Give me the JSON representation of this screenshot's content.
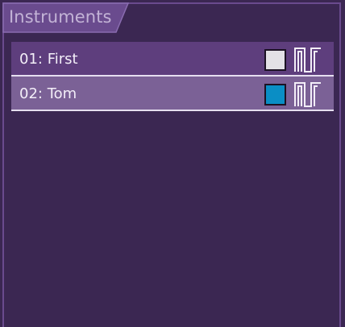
{
  "panel": {
    "tab_label": "Instruments"
  },
  "instruments": [
    {
      "label": "01: First",
      "color": "#e3e1e6",
      "waveform": "square-wave-icon"
    },
    {
      "label": "02: Tom",
      "color": "#0a8ec5",
      "waveform": "square-wave-icon"
    }
  ],
  "colors": {
    "background": "#3b2752",
    "row_1": "#5e3e7d",
    "row_2": "#7b6196",
    "border": "#6a4b8e"
  }
}
